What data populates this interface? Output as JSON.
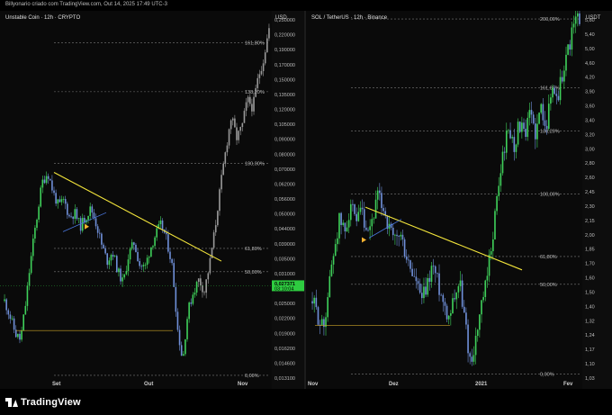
{
  "topbar": {
    "text": "Billyonario criado com TradingView.com, Out 14, 2025 17:49 UTC-3"
  },
  "footer": {
    "brand": "TradingView"
  },
  "colors": {
    "up": "#3fd05a",
    "down": "#6f8fd8",
    "trend": "#f2e43b",
    "fib": "#7a7a7a",
    "background": "#0a0a0a",
    "price_tag": "#2ecc40"
  },
  "chart_data": [
    {
      "type": "candlestick",
      "title": "Unstable Coin · 12h · CRYPTO",
      "unit": "USD",
      "y_ticks": [
        "0,250000",
        "0,220000",
        "0,190000",
        "0,170000",
        "0,150000",
        "0,135000",
        "0,120000",
        "0,105000",
        "0,090000",
        "0,080000",
        "0,070000",
        "0,062000",
        "0,056000",
        "0,050000",
        "0,044000",
        "0,039000",
        "0,035000",
        "0,031000",
        "0,027000",
        "0,025000",
        "0,022000",
        "0,019000",
        "0,016200",
        "0,014600",
        "0,013100"
      ],
      "x_ticks": [
        "Set",
        "Out",
        "Nov"
      ],
      "fib_levels": [
        {
          "label": "161,80%",
          "value": 0.23
        },
        {
          "label": "138,20%",
          "value": 0.15
        },
        {
          "label": "100,00%",
          "value": 0.08
        },
        {
          "label": "61,80%",
          "value": 0.038
        },
        {
          "label": "50,00%",
          "value": 0.031
        },
        {
          "label": "0,00%",
          "value": 0.0125
        }
      ],
      "current_price": {
        "price": "0,027371",
        "timer": "03:10:04",
        "value": 0.0274
      },
      "price_path": [
        0.024,
        0.021,
        0.018,
        0.017,
        0.024,
        0.036,
        0.05,
        0.068,
        0.074,
        0.062,
        0.055,
        0.058,
        0.05,
        0.052,
        0.046,
        0.05,
        0.054,
        0.047,
        0.039,
        0.034,
        0.037,
        0.031,
        0.028,
        0.036,
        0.04,
        0.033,
        0.032,
        0.038,
        0.043,
        0.047,
        0.041,
        0.033,
        0.019,
        0.014,
        0.022,
        0.026,
        0.029,
        0.026,
        0.033,
        0.045,
        0.065,
        0.09,
        0.12,
        0.1,
        0.11,
        0.14,
        0.13,
        0.17,
        0.2,
        0.26
      ]
    },
    {
      "type": "candlestick",
      "title": "SOL / TetherUS · 12h · Binance",
      "unit": "USDT",
      "y_ticks": [
        "5,80",
        "5,40",
        "5,00",
        "4,60",
        "4,20",
        "3,90",
        "3,60",
        "3,40",
        "3,20",
        "3,00",
        "2,80",
        "2,60",
        "2,45",
        "2,30",
        "2,15",
        "2,00",
        "1,85",
        "1,70",
        "1,60",
        "1,50",
        "1,40",
        "1,32",
        "1,24",
        "1,17",
        "1,10",
        "1,03"
      ],
      "x_ticks": [
        "Nov",
        "Dez",
        "2021",
        "Fev"
      ],
      "fib_levels": [
        {
          "label": "200,00%",
          "value": 6.1
        },
        {
          "label": "161,80%",
          "value": 4.3
        },
        {
          "label": "138,20%",
          "value": 3.45
        },
        {
          "label": "100,00%",
          "value": 2.5
        },
        {
          "label": "61,80%",
          "value": 1.82
        },
        {
          "label": "50,00%",
          "value": 1.58
        },
        {
          "label": "0,00%",
          "value": 1.0
        }
      ],
      "price_path": [
        1.45,
        1.35,
        1.25,
        1.55,
        1.9,
        2.2,
        2.05,
        2.4,
        2.1,
        2.3,
        1.95,
        2.2,
        2.45,
        2.35,
        2.1,
        1.95,
        2.05,
        1.85,
        1.7,
        1.6,
        1.45,
        1.55,
        1.75,
        1.6,
        1.45,
        1.35,
        1.5,
        1.6,
        1.3,
        1.05,
        1.2,
        1.4,
        1.6,
        2.0,
        2.5,
        3.1,
        3.5,
        3.2,
        3.6,
        3.3,
        3.8,
        3.4,
        3.9,
        3.6,
        4.3,
        4.1,
        4.7,
        5.3,
        5.9,
        6.2
      ]
    }
  ]
}
